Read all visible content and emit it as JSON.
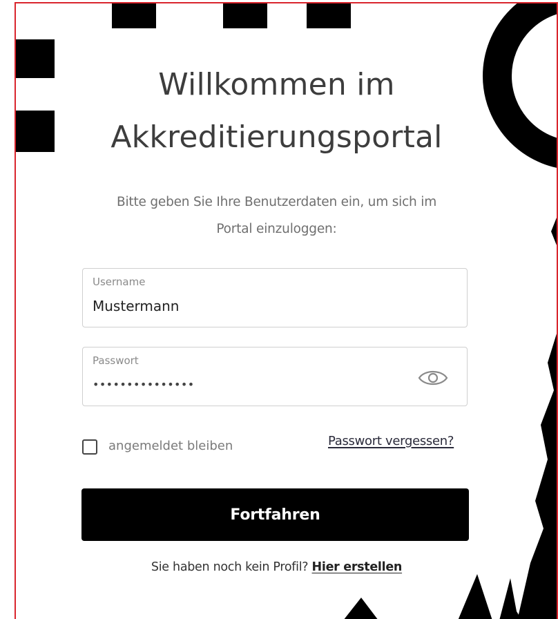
{
  "login": {
    "title_line1": "Willkommen im",
    "title_line2": "Akkreditierungsportal",
    "subtitle_line1": "Bitte geben Sie Ihre Benutzerdaten ein, um sich im",
    "subtitle_line2": "Portal einzuloggen:",
    "username": {
      "label": "Username",
      "value": "Mustermann"
    },
    "password": {
      "label": "Passwort",
      "masked_value": "•••••••••••••••",
      "toggle_icon": "eye-icon"
    },
    "remember_label": "angemeldet bleiben",
    "remember_checked": false,
    "forgot_link": "Passwort vergessen?",
    "submit_label": "Fortfahren",
    "register_prompt": "Sie haben noch kein Profil?",
    "register_link": "Hier erstellen"
  },
  "colors": {
    "frame_border": "#d9242c",
    "button_bg": "#000000",
    "button_text": "#ffffff",
    "title_text": "#3d3d3d",
    "muted_text": "#6f6f6f",
    "field_border": "#cfcfcf"
  }
}
